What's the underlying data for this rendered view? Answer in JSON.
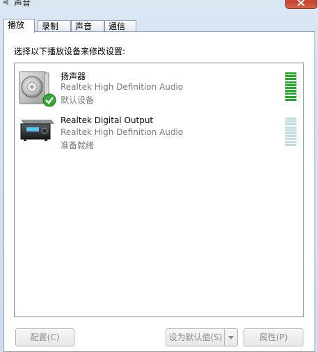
{
  "window": {
    "title": "声音"
  },
  "tabs": [
    {
      "label": "播放",
      "active": true
    },
    {
      "label": "录制",
      "active": false
    },
    {
      "label": "声音",
      "active": false
    },
    {
      "label": "通信",
      "active": false
    }
  ],
  "instruction": "选择以下播放设备来修改设置:",
  "devices": [
    {
      "name": "扬声器",
      "description": "Realtek High Definition Audio",
      "status": "默认设备",
      "icon": "speaker-icon",
      "default": true,
      "meter_level": 1.0
    },
    {
      "name": "Realtek Digital Output",
      "description": "Realtek High Definition Audio",
      "status": "准备就绪",
      "icon": "digital-output-icon",
      "default": false,
      "meter_level": 0
    }
  ],
  "buttons": {
    "configure": "配置(C)",
    "set_default": "设为默认值(S)",
    "properties": "属性(P)"
  },
  "colors": {
    "meter_active": "#2fa12f",
    "meter_inactive": "#c5dbe4",
    "disabled_text": "#8d8d8d"
  }
}
